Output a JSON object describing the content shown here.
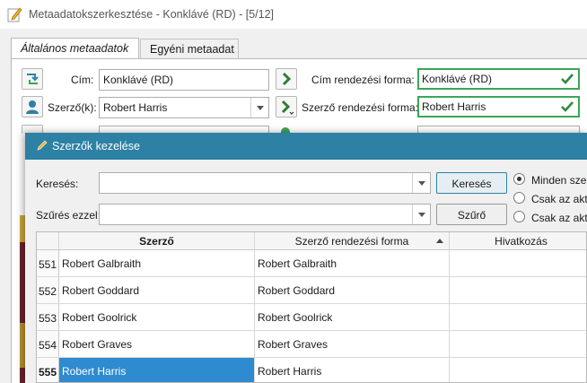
{
  "window": {
    "title": "Metaadatokszerkesztése - Konklávé (RD) - [5/12]"
  },
  "tabs": [
    {
      "label": "Általános metaadatok",
      "active": true
    },
    {
      "label": "Egyéni metaadat",
      "active": false
    }
  ],
  "form": {
    "title_label": "Cím:",
    "title_value": "Konklávé (RD)",
    "title_sort_label": "Cím rendezési forma:",
    "title_sort_value": "Konklávé (RD)",
    "author_label": "Szerző(k):",
    "author_value": "Robert Harris",
    "author_sort_label": "Szerző rendezési forma:",
    "author_sort_value": "Robert Harris"
  },
  "dialog": {
    "title": "Szerzők kezelése",
    "search_label": "Keresés:",
    "search_value": "",
    "search_button": "Keresés",
    "filter_label": "Szűrés ezzel:",
    "filter_value": "",
    "filter_button": "Szűrő",
    "radios": [
      {
        "label": "Minden szer",
        "checked": true
      },
      {
        "label": "Csak az aktu",
        "checked": false
      },
      {
        "label": "Csak az aktu",
        "checked": false
      }
    ],
    "table": {
      "columns": [
        "Szerző",
        "Szerző rendezési forma",
        "Hivatkozás"
      ],
      "sorted_column": "Szerző rendezési forma",
      "rows": [
        {
          "num": "551",
          "author": "Robert Galbraith",
          "sort": "Robert Galbraith",
          "link": ""
        },
        {
          "num": "552",
          "author": "Robert Goddard",
          "sort": "Robert Goddard",
          "link": ""
        },
        {
          "num": "553",
          "author": "Robert Goolrick",
          "sort": "Robert Goolrick",
          "link": ""
        },
        {
          "num": "554",
          "author": "Robert Graves",
          "sort": "Robert Graves",
          "link": ""
        },
        {
          "num": "555",
          "author": "Robert Harris",
          "sort": "Robert Harris",
          "link": "",
          "selected": true
        }
      ]
    }
  },
  "colors": {
    "accent": "#2d81a4",
    "selection": "#2e8bcf",
    "valid": "#3aa657",
    "arrow": "#2e7d32"
  }
}
